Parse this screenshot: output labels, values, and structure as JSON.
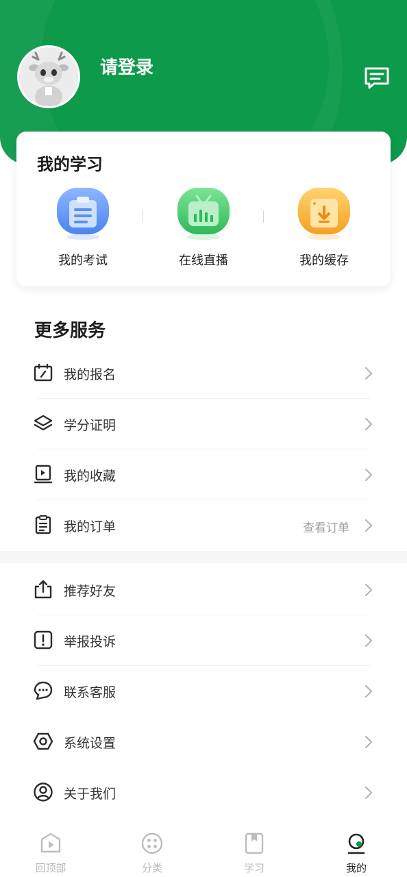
{
  "header": {
    "login_text": "请登录",
    "accent_color": "#0e9a4b"
  },
  "study": {
    "title": "我的学习",
    "items": [
      {
        "label": "我的考试",
        "icon": "exam-clipboard-icon",
        "color": "#5b8ff0"
      },
      {
        "label": "在线直播",
        "icon": "live-tv-icon",
        "color": "#38c463"
      },
      {
        "label": "我的缓存",
        "icon": "download-cache-icon",
        "color": "#f5a623"
      }
    ]
  },
  "services": {
    "title": "更多服务",
    "group1": [
      {
        "label": "我的报名",
        "icon": "calendar-icon"
      },
      {
        "label": "学分证明",
        "icon": "layers-icon"
      },
      {
        "label": "我的收藏",
        "icon": "bookmark-video-icon"
      },
      {
        "label": "我的订单",
        "icon": "order-clipboard-icon",
        "extra": "查看订单"
      }
    ],
    "group2": [
      {
        "label": "推荐好友",
        "icon": "share-upload-icon"
      },
      {
        "label": "举报投诉",
        "icon": "report-alert-icon"
      },
      {
        "label": "联系客服",
        "icon": "chat-bubble-icon"
      },
      {
        "label": "系统设置",
        "icon": "settings-hexagon-icon"
      },
      {
        "label": "关于我们",
        "icon": "user-circle-icon"
      }
    ]
  },
  "tabbar": {
    "tabs": [
      {
        "label": "回顶部",
        "icon": "play-home-icon",
        "active": false
      },
      {
        "label": "分类",
        "icon": "category-dots-icon",
        "active": false
      },
      {
        "label": "学习",
        "icon": "study-book-icon",
        "active": false
      },
      {
        "label": "我的",
        "icon": "profile-icon",
        "active": true
      }
    ]
  }
}
